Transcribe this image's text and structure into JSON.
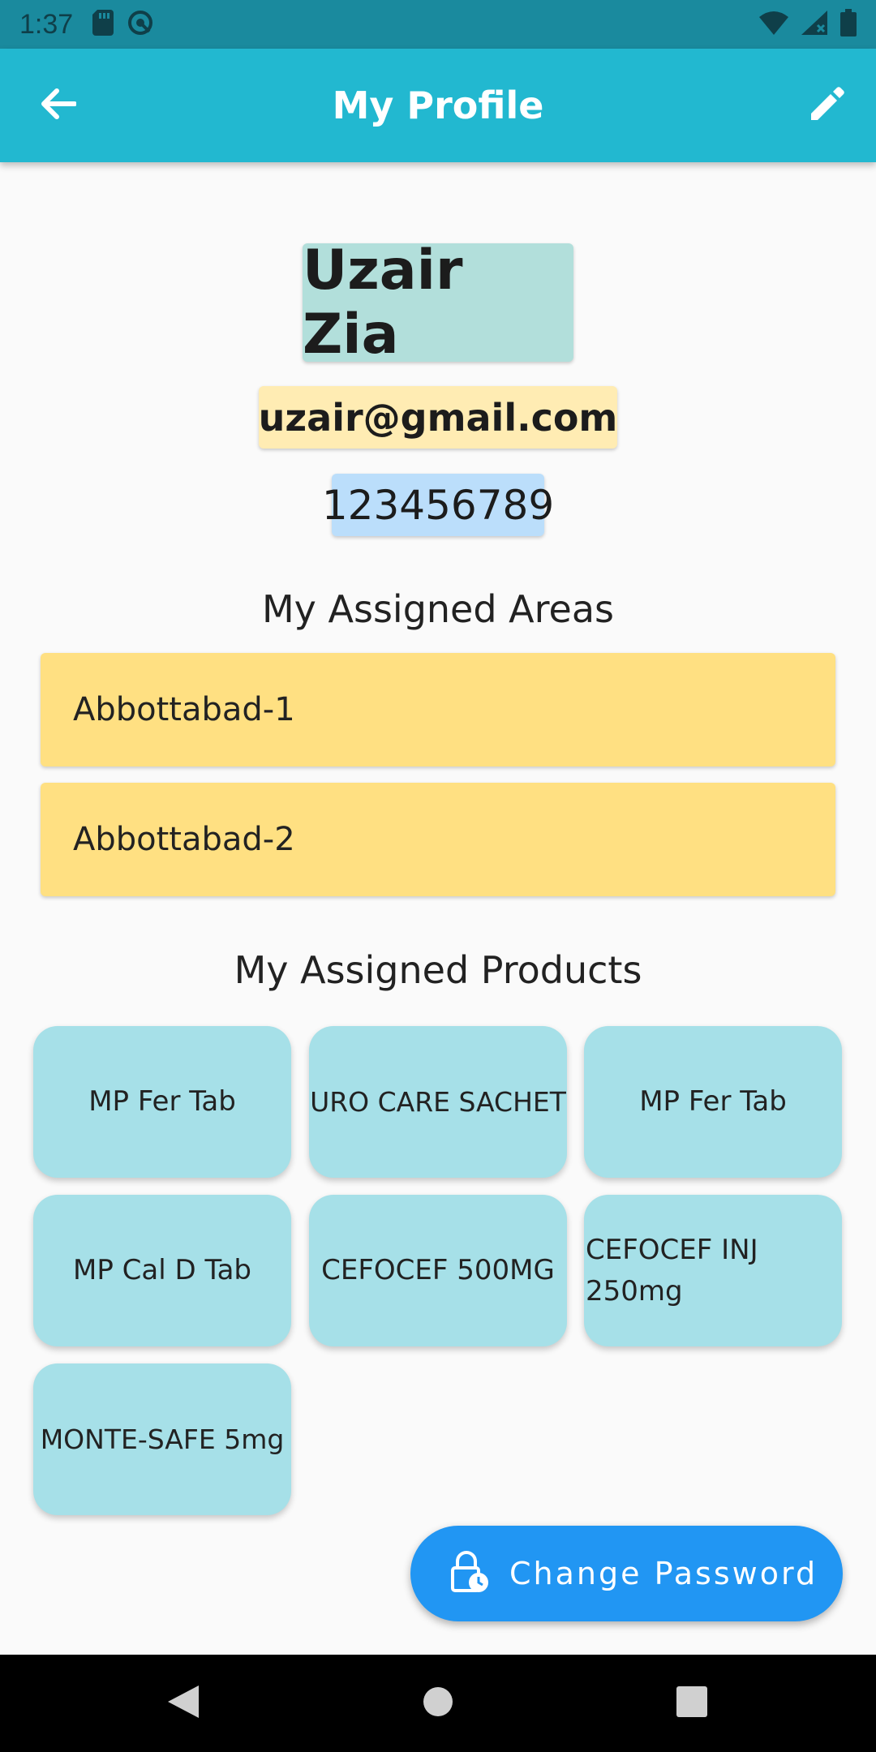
{
  "status_bar": {
    "time": "1:37",
    "icons": [
      "sd-card-icon",
      "sync-icon",
      "wifi-icon",
      "signal-icon",
      "battery-icon"
    ]
  },
  "app_bar": {
    "title": "My Profile",
    "back_icon": "arrow-left-icon",
    "edit_icon": "pencil-icon"
  },
  "profile": {
    "name": "Uzair Zia",
    "email": "uzair@gmail.com",
    "phone": "123456789"
  },
  "areas": {
    "heading": "My Assigned Areas",
    "items": [
      "Abbottabad-1",
      "Abbottabad-2"
    ]
  },
  "products": {
    "heading": "My Assigned Products",
    "items": [
      "MP Fer Tab",
      "URO CARE SACHET",
      "MP Fer Tab",
      "MP Cal D Tab",
      "CEFOCEF 500MG",
      "CEFOCEF INJ 250mg",
      "MONTE-SAFE 5mg"
    ]
  },
  "fab": {
    "label": "Change Password",
    "icon": "lock-clock-icon"
  },
  "nav_bar": {
    "icons": [
      "back-triangle-icon",
      "home-circle-icon",
      "recents-square-icon"
    ]
  },
  "colors": {
    "app_bar": "#22b8d0",
    "status_bar": "#1a8a9e",
    "name_chip": "#b2dfdb",
    "email_chip": "#ffecb3",
    "phone_chip": "#bbdefb",
    "area_card": "#ffe082",
    "product_card": "#a6e0e8",
    "fab": "#2196f3"
  }
}
